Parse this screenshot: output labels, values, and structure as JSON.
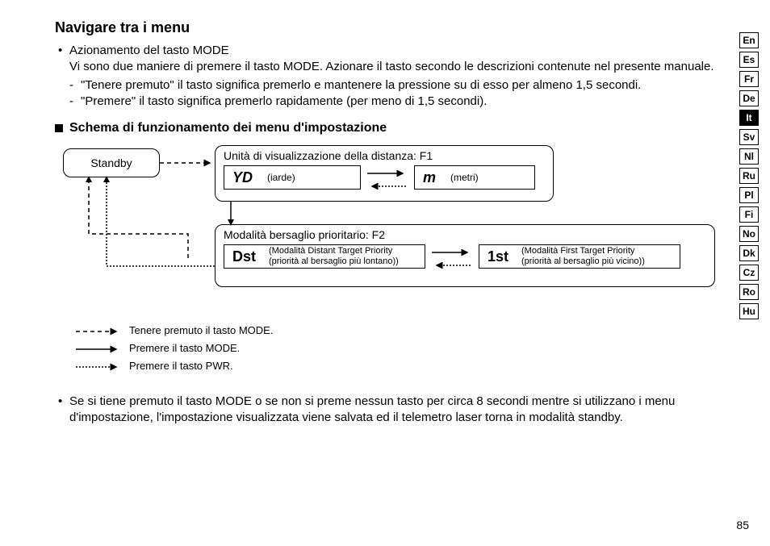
{
  "title": "Navigare tra i menu",
  "mode_line": "Azionamento del tasto MODE",
  "mode_body": "Vi sono due maniere di premere il tasto MODE. Azionare il tasto secondo le descrizioni contenute nel presente manuale.",
  "dash1": "\"Tenere premuto\" il tasto significa premerlo e mantenere la pressione su di esso per almeno 1,5 secondi.",
  "dash2": "\"Premere\" il tasto significa premerlo rapidamente (per meno di 1,5 secondi).",
  "section": "Schema di funzionamento dei menu d'impostazione",
  "standby": "Standby",
  "f1_label": "Unità di visualizzazione della distanza: F1",
  "f1_opt1_sym": "YD",
  "f1_opt1_txt": "(iarde)",
  "f1_opt2_sym": "m",
  "f1_opt2_txt": "(metri)",
  "f2_label": "Modalità bersaglio prioritario: F2",
  "f2_opt1_sym": "Dst",
  "f2_opt1_txt_a": "(Modalità Distant Target Priority",
  "f2_opt1_txt_b": "(priorità al bersaglio più lontano))",
  "f2_opt2_sym": "1st",
  "f2_opt2_txt_a": "(Modalità First Target Priority",
  "f2_opt2_txt_b": "(priorità al bersaglio più vicino))",
  "legend1": "Tenere premuto il tasto MODE.",
  "legend2": "Premere il tasto MODE.",
  "legend3": "Premere il tasto PWR.",
  "bottom": "Se si tiene premuto il tasto MODE o se non si preme nessun tasto per circa 8 secondi mentre si utilizzano i menu d'impostazione, l'impostazione visualizzata viene salvata ed il telemetro laser torna in modalità standby.",
  "langs": [
    "En",
    "Es",
    "Fr",
    "De",
    "It",
    "Sv",
    "Nl",
    "Ru",
    "Pl",
    "Fi",
    "No",
    "Dk",
    "Cz",
    "Ro",
    "Hu"
  ],
  "active_lang": "It",
  "page_num": "85"
}
